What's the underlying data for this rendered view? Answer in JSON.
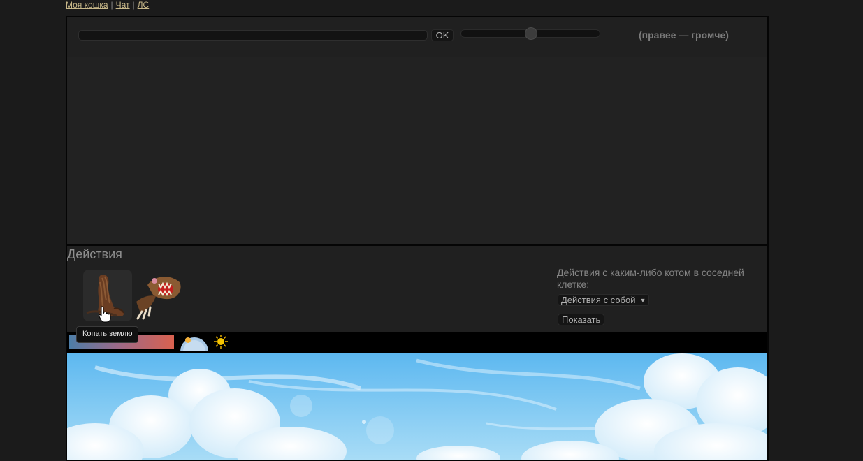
{
  "topnav": {
    "links": [
      {
        "label": "Моя кошка"
      },
      {
        "label": "Чат"
      },
      {
        "label": "ЛС"
      }
    ],
    "separator": "|"
  },
  "chat": {
    "input_value": "",
    "ok_label": "OK",
    "volume": 0.5,
    "volume_hint": "(правее — громче)"
  },
  "actions": {
    "title": "Действия",
    "items": [
      {
        "icon": "dig-paw-icon",
        "tooltip": "Копать землю"
      },
      {
        "icon": "jaw-claws-icon"
      }
    ],
    "neighbor_label": "Действия с каким-либо котом в соседней клетке:",
    "neighbor_select_value": "Действия с собой",
    "show_label": "Показать"
  },
  "status": {
    "temperature_icon": "temperature-gradient",
    "weather_icon": "sky-dome-icon",
    "time_icon": "sun-icon"
  },
  "colors": {
    "background": "#1b1b1b",
    "panel": "#202020",
    "link": "#c9b98a",
    "sky": "#7fc7f2"
  }
}
